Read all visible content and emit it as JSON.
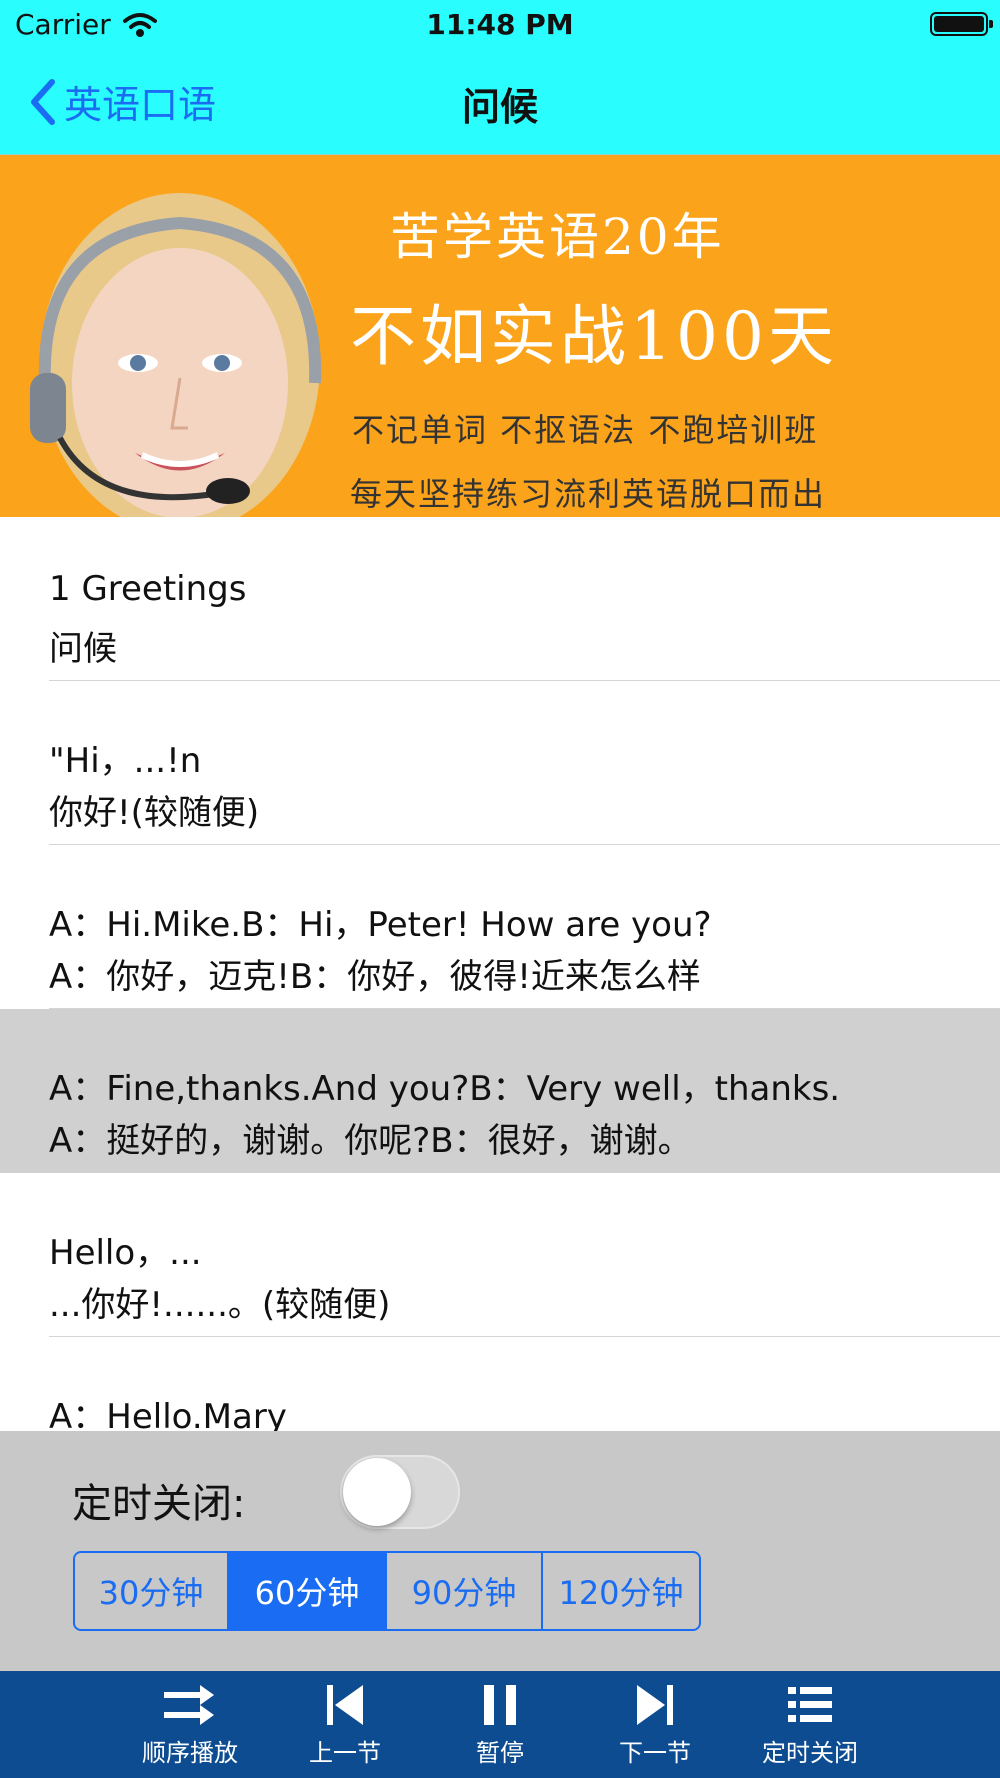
{
  "status_bar": {
    "carrier": "Carrier",
    "time": "11:48 PM"
  },
  "nav": {
    "back_label": "英语口语",
    "title": "问候"
  },
  "banner": {
    "line1": "苦学英语20年",
    "line2": "不如实战100天",
    "line3": "不记单词  不抠语法  不跑培训班",
    "line4": "每天坚持练习流利英语脱口而出"
  },
  "lessons": [
    {
      "en": "1 Greetings",
      "zh": "问候"
    },
    {
      "en": "\"Hi，...!n",
      "zh": "你好!(较随便)"
    },
    {
      "en": "A：Hi.Mike.B：Hi，Peter! How are you?",
      "zh": "A：你好，迈克!B：你好，彼得!近来怎么样"
    },
    {
      "en": "A：Fine,thanks.And you?B：Very well，thanks.",
      "zh": "A：挺好的，谢谢。你呢?B：很好，谢谢。"
    },
    {
      "en": "Hello，...",
      "zh": "...你好!......。(较随便)"
    },
    {
      "en": "A：Hello.Mary",
      "zh": ""
    }
  ],
  "selected_lesson_index": 3,
  "timer": {
    "label": "定时关闭:",
    "enabled": false,
    "options": [
      "30分钟",
      "60分钟",
      "90分钟",
      "120分钟"
    ],
    "selected_option": "60分钟"
  },
  "toolbar": {
    "order_label": "顺序播放",
    "prev_label": "上一节",
    "pause_label": "暂停",
    "next_label": "下一节",
    "timer_label": "定时关闭"
  },
  "colors": {
    "nav_bg": "#29fdfd",
    "accent": "#1a6df2",
    "banner_bg": "#fba41b",
    "toolbar_bg": "#0d4c91",
    "selected_row_bg": "#d0d0d0",
    "panel_bg": "#c8c8c8"
  }
}
